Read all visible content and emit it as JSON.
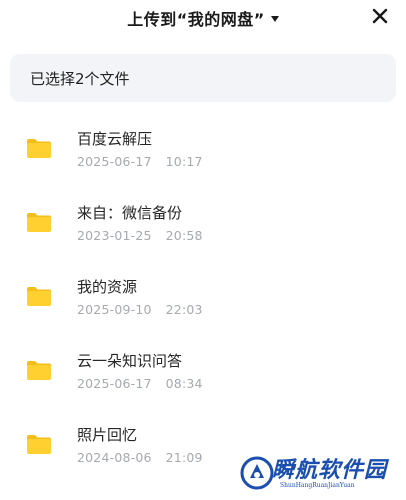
{
  "header": {
    "title": "上传到“我的网盘”",
    "dropdown_icon": "caret-down-icon",
    "close_icon": "close-icon"
  },
  "selection": {
    "text": "已选择2个文件"
  },
  "folders": [
    {
      "name": "百度云解压",
      "date": "2025-06-17",
      "time": "10:17"
    },
    {
      "name": "来自：微信备份",
      "date": "2023-01-25",
      "time": "20:58"
    },
    {
      "name": "我的资源",
      "date": "2025-09-10",
      "time": "22:03"
    },
    {
      "name": "云一朵知识问答",
      "date": "2025-06-17",
      "time": "08:34"
    },
    {
      "name": "照片回忆",
      "date": "2024-08-06",
      "time": "21:09"
    }
  ],
  "colors": {
    "folder": "#ffd02f",
    "folder_tab": "#f3bd1a",
    "accent": "#1a4fb0"
  },
  "watermark": {
    "text": "瞬航软件园",
    "sub": "ShunHangRuanJianYuan"
  }
}
